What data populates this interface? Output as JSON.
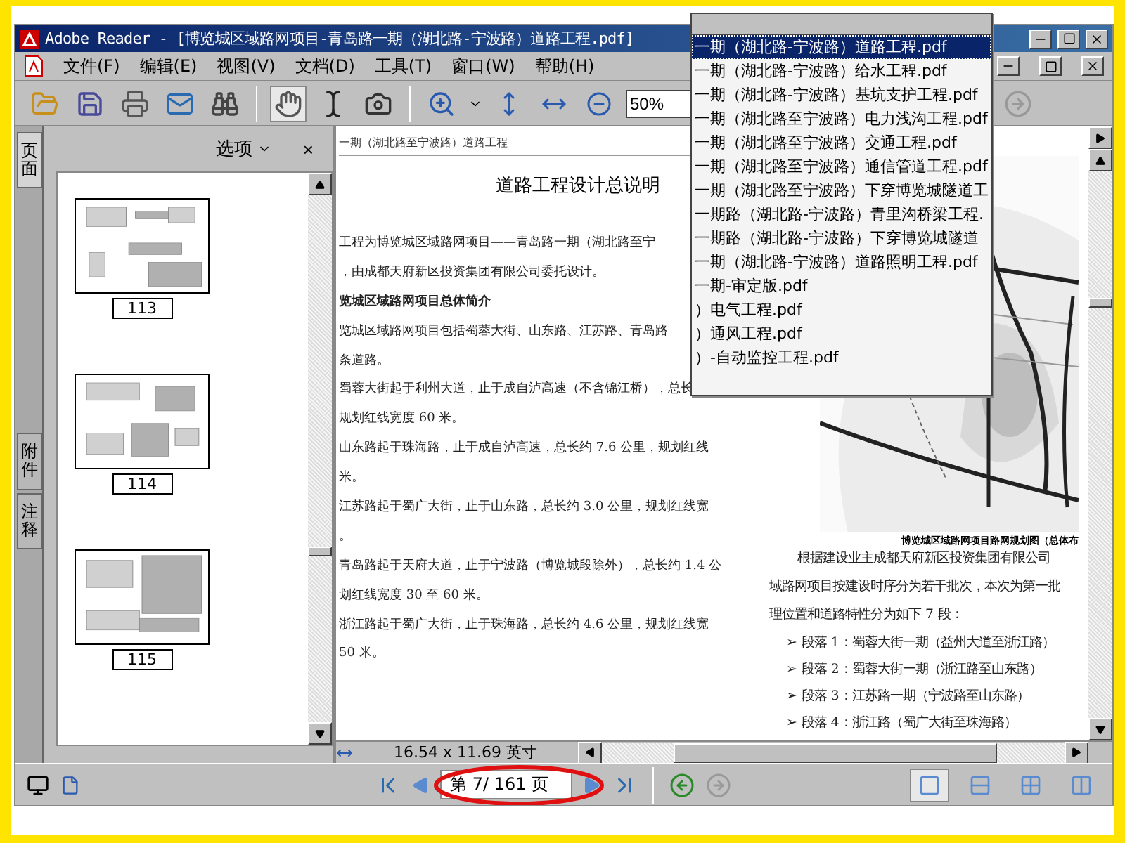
{
  "window": {
    "title": "Adobe Reader - [博览城区域路网项目-青岛路一期（湖北路-宁波路）道路工程.pdf]"
  },
  "menu": [
    {
      "label": "文件(F)"
    },
    {
      "label": "编辑(E)"
    },
    {
      "label": "视图(V)"
    },
    {
      "label": "文档(D)"
    },
    {
      "label": "工具(T)"
    },
    {
      "label": "窗口(W)"
    },
    {
      "label": "帮助(H)"
    }
  ],
  "toolbar": {
    "zoom": "50%"
  },
  "side_panel": {
    "tabs": [
      {
        "label": "页面",
        "selected": true
      },
      {
        "label": "附件",
        "selected": false
      },
      {
        "label": "注释",
        "selected": false
      }
    ],
    "options": "选项",
    "close": "×",
    "thumbnails": [
      {
        "page": "113",
        "kind": "a"
      },
      {
        "page": "114",
        "kind": "b"
      },
      {
        "page": "115",
        "kind": "c"
      }
    ]
  },
  "document": {
    "header": "一期（湖北路至宁波路）道路工程",
    "title": "道路工程设计总说明",
    "left_lines": [
      {
        "text": "工程为博览城区域路网项目——青岛路一期（湖北路至宁",
        "kind": "body"
      },
      {
        "text": "，由成都天府新区投资集团有限公司委托设计。",
        "kind": "body"
      },
      {
        "text": "览城区域路网项目总体简介",
        "kind": "heading"
      },
      {
        "text": "览城区域路网项目包括蜀蓉大街、山东路、江苏路、青岛路",
        "kind": "body"
      },
      {
        "text": "条道路。",
        "kind": "body"
      },
      {
        "text": "蜀蓉大街起于利州大道，止于成自泸高速（不含锦江桥），总长",
        "kind": "body"
      },
      {
        "text": "规划红线宽度 60 米。",
        "kind": "body"
      },
      {
        "text": "山东路起于珠海路，止于成自泸高速，总长约 7.6 公里，规划红线",
        "kind": "body"
      },
      {
        "text": "米。",
        "kind": "body"
      },
      {
        "text": "江苏路起于蜀广大街，止于山东路，总长约 3.0 公里，规划红线宽",
        "kind": "body"
      },
      {
        "text": "。",
        "kind": "body"
      },
      {
        "text": "青岛路起于天府大道，止于宁波路（博览城段除外），总长约 1.4 公",
        "kind": "body"
      },
      {
        "text": "划红线宽度 30 至 60 米。",
        "kind": "body"
      },
      {
        "text": "浙江路起于蜀广大街，止于珠海路，总长约 4.6 公里，规划红线宽",
        "kind": "body"
      },
      {
        "text": "50 米。",
        "kind": "body"
      }
    ],
    "figure_caption": "博览城区域路网项目路网规划图（总体布",
    "right_lines": [
      "根据建设业主成都天府新区投资集团有限公司",
      "域路网项目按建设时序分为若干批次，本次为第一批",
      "理位置和道路特性分为如下 7 段："
    ],
    "bullet_mark": "➢",
    "bullets": [
      "段落 1：蜀蓉大街一期（益州大道至浙江路）",
      "段落 2：蜀蓉大街一期（浙江路至山东路）",
      "段落 3：江苏路一期（宁波路至山东路）",
      "段落 4：浙江路（蜀广大街至珠海路）"
    ]
  },
  "page_size": "16.54 x 11.69 英寸",
  "navigation": {
    "page": "第 7/ 161 页"
  },
  "view_modes": [
    {
      "kind": "single",
      "selected": true
    },
    {
      "kind": "continuous",
      "selected": false
    },
    {
      "kind": "grid",
      "selected": false
    },
    {
      "kind": "facing",
      "selected": false
    }
  ],
  "window_list": [
    {
      "label": "一期（湖北路-宁波路）道路工程.pdf",
      "selected": true
    },
    {
      "label": "一期（湖北路-宁波路）给水工程.pdf",
      "selected": false
    },
    {
      "label": "一期（湖北路-宁波路）基坑支护工程.pdf",
      "selected": false
    },
    {
      "label": "一期（湖北路至宁波路）电力浅沟工程.pdf",
      "selected": false
    },
    {
      "label": "一期（湖北路至宁波路）交通工程.pdf",
      "selected": false
    },
    {
      "label": "一期（湖北路至宁波路）通信管道工程.pdf",
      "selected": false
    },
    {
      "label": "一期（湖北路至宁波路）下穿博览城隧道工",
      "selected": false
    },
    {
      "label": "一期路（湖北路-宁波路）青里沟桥梁工程.",
      "selected": false
    },
    {
      "label": "一期路（湖北路-宁波路）下穿博览城隧道",
      "selected": false
    },
    {
      "label": "一期（湖北路-宁波路）道路照明工程.pdf",
      "selected": false
    },
    {
      "label": "一期-审定版.pdf",
      "selected": false
    },
    {
      "label": "）电气工程.pdf",
      "selected": false
    },
    {
      "label": "）通风工程.pdf",
      "selected": false
    },
    {
      "label": "）-自动监控工程.pdf",
      "selected": false
    }
  ]
}
